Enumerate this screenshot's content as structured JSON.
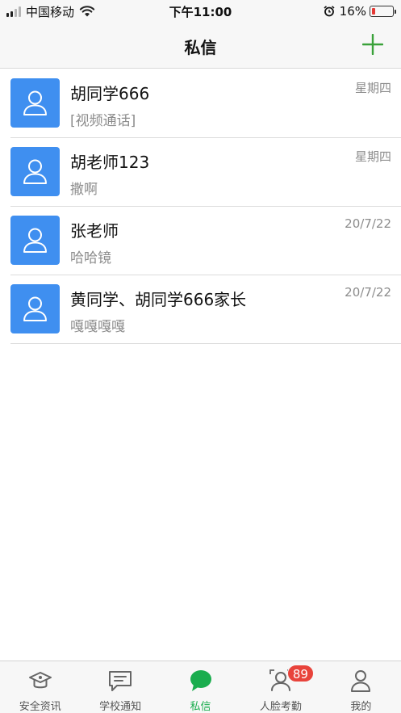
{
  "status_bar": {
    "carrier": "中国移动",
    "time": "下午11:00",
    "battery_percent": "16%",
    "battery_level": 0.16,
    "battery_color": "#e53935"
  },
  "nav": {
    "title": "私信",
    "add_icon": "plus-icon",
    "accent": "#3aa13a"
  },
  "conversations": [
    {
      "name": "胡同学666",
      "preview": "[视频通话]",
      "time": "星期四",
      "avatar_icon": "person-icon"
    },
    {
      "name": "胡老师123",
      "preview": "撒啊",
      "time": "星期四",
      "avatar_icon": "person-icon"
    },
    {
      "name": "张老师",
      "preview": "哈哈镜",
      "time": "20/7/22",
      "avatar_icon": "person-icon"
    },
    {
      "name": "黄同学、胡同学666家长",
      "preview": "嘎嘎嘎嘎",
      "time": "20/7/22",
      "avatar_icon": "person-icon"
    }
  ],
  "avatar_color": "#3f8ff0",
  "tabs": [
    {
      "label": "安全资讯",
      "icon": "graduation-cap-icon",
      "active": false
    },
    {
      "label": "学校通知",
      "icon": "message-board-icon",
      "active": false
    },
    {
      "label": "私信",
      "icon": "chat-bubble-icon",
      "active": true
    },
    {
      "label": "人脸考勤",
      "icon": "face-scan-icon",
      "active": false,
      "badge": "89"
    },
    {
      "label": "我的",
      "icon": "profile-icon",
      "active": false
    }
  ],
  "tab_active_color": "#1aad4e",
  "badge_color": "#e8433b"
}
